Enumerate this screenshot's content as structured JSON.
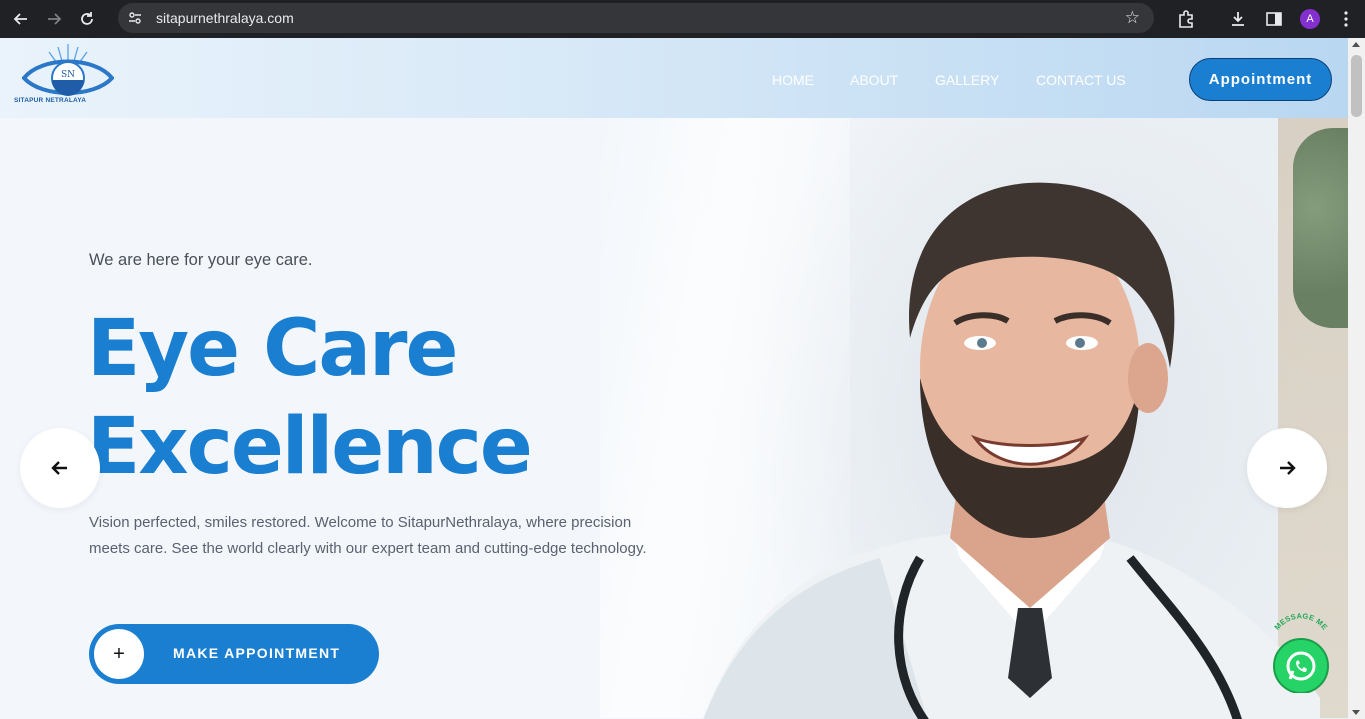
{
  "browser": {
    "url": "sitapurnethralaya.com",
    "profile_initial": "A",
    "icons": [
      "back-icon",
      "forward-icon",
      "reload-icon",
      "site-info-icon",
      "bookmark-star-icon",
      "extensions-icon",
      "download-icon",
      "side-panel-icon",
      "avatar",
      "more-menu-icon"
    ]
  },
  "header": {
    "logo_text": "SITAPUR NETRALAYA",
    "nav": [
      "HOME",
      "ABOUT",
      "GALLERY",
      "CONTACT US"
    ],
    "appointment_label": "Appointment"
  },
  "hero": {
    "tagline": "We are here for your eye care.",
    "headline_line1": "Eye Care",
    "headline_line2": "Excellence",
    "description": "Vision perfected, smiles restored. Welcome to SitapurNethralaya, where precision meets care. See the world clearly with our expert team and cutting-edge technology.",
    "cta_label": "MAKE APPOINTMENT",
    "cta_icon": "+"
  },
  "widgets": {
    "whatsapp_label": "MESSAGE ME"
  },
  "colors": {
    "brand_blue": "#1b7fd1",
    "chrome_dark": "#202124",
    "whatsapp_green": "#25d366"
  }
}
